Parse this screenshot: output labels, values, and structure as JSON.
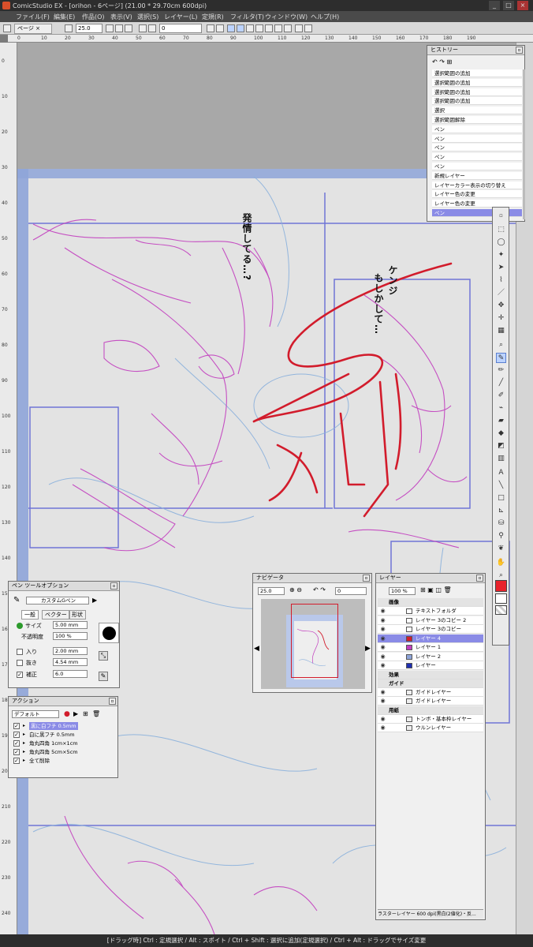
{
  "window": {
    "title": "ComicStudio EX - [orihon - 6ページ] (21.00 * 29.70cm 600dpi)",
    "min_label": "_",
    "max_label": "□",
    "close_label": "×"
  },
  "menu": [
    "ファイル(F)",
    "編集(E)",
    "作品(O)",
    "表示(V)",
    "選択(S)",
    "レイヤー(L)",
    "定規(R)",
    "フィルタ(T)",
    "ウィンドウ(W)",
    "ヘルプ(H)"
  ],
  "toolbar": {
    "tab_label": "ページ",
    "zoom": "25.0",
    "angle": "0"
  },
  "ruler_h": [
    "0",
    "10",
    "20",
    "30",
    "40",
    "50",
    "60",
    "70",
    "80",
    "90",
    "100",
    "110",
    "120",
    "130",
    "140",
    "150",
    "160",
    "170",
    "180",
    "190"
  ],
  "ruler_v": [
    "0",
    "10",
    "20",
    "30",
    "40",
    "50",
    "60",
    "70",
    "80",
    "90",
    "100",
    "110",
    "120",
    "130",
    "140",
    "150",
    "160",
    "170",
    "180",
    "190",
    "200",
    "210",
    "220",
    "230",
    "240"
  ],
  "speech": {
    "left": "発情してる…?",
    "right_col1": "ケンジ",
    "right_col2": "もしかして…"
  },
  "history": {
    "title": "ヒストリー",
    "items": [
      "選択範囲の追加",
      "選択範囲の追加",
      "選択範囲の追加",
      "選択範囲の追加",
      "選択",
      "選択範囲解除",
      "ペン",
      "ペン",
      "ペン",
      "ペン",
      "ペン",
      "新規レイヤー",
      "レイヤーカラー表示の切り替え",
      "レイヤー色の変更",
      "レイヤー色の変更",
      "ペン"
    ],
    "selected_index": 15
  },
  "pen_options": {
    "title": "ペン ツールオプション",
    "preset": "カスタムGペン",
    "tabs": [
      "一般",
      "ベクター",
      "形状"
    ],
    "size_label": "サイズ",
    "size_value": "5.00 mm",
    "opacity_label": "不透明度",
    "opacity_value": "100 %",
    "in_label": "入り",
    "in_value": "2.00 mm",
    "out_label": "抜き",
    "out_value": "4.54 mm",
    "smooth_label": "補正",
    "smooth_value": "6.0"
  },
  "actions": {
    "title": "アクション",
    "set_name": "デフォルト",
    "items": [
      "黒に白フチ 0.5mm",
      "白に黒フチ 0.5mm",
      "角丸四角 1cm×1cm",
      "角丸四角 5cm×5cm",
      "全て削除"
    ],
    "selected_index": 0
  },
  "navigator": {
    "title": "ナビゲータ",
    "zoom": "25.0",
    "angle": "0"
  },
  "layers": {
    "title": "レイヤー",
    "opacity": "100 %",
    "groups": [
      "画像",
      "効果",
      "ガイド",
      "用紙"
    ],
    "rows": [
      {
        "name": "テキストフォルダ",
        "color": "#ffffff"
      },
      {
        "name": "レイヤー 3のコピー 2",
        "color": "#ffffff"
      },
      {
        "name": "レイヤー 3のコピー",
        "color": "#ffffff"
      },
      {
        "name": "レイヤー 4",
        "color": "#d21c2c"
      },
      {
        "name": "レイヤー 1",
        "color": "#c23fbf"
      },
      {
        "name": "レイヤー 2",
        "color": "#8ea4d8"
      },
      {
        "name": "レイヤー",
        "color": "#1f2fb0"
      }
    ],
    "guide_rows": [
      "ガイドレイヤー",
      "ガイドレイヤー"
    ],
    "paper_rows": [
      "トンボ・基本枠レイヤー",
      "ウルンレイヤー"
    ],
    "selected_index": 3,
    "footer": "ラスターレイヤー 600 dpi(黒白(2値化)・反..."
  },
  "colors": {
    "primary": "#e8232c",
    "secondary": "#ffffff"
  },
  "status": "[ドラッグ時] Ctrl : 定規選択 / Alt : スポイト / Ctrl + Shift : 選択に追加(定規選択) / Ctrl + Alt : ドラッグでサイズ変更"
}
